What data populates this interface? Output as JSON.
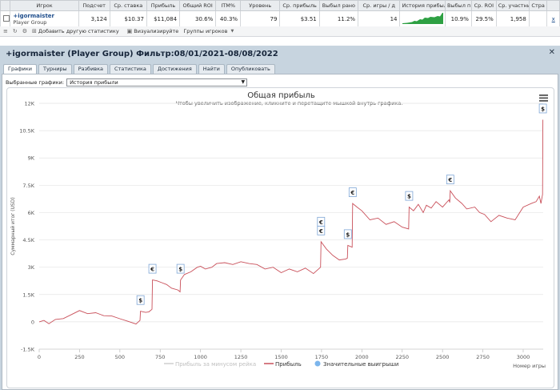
{
  "stats_table": {
    "headers": [
      "",
      "Игрок",
      "Подсчет",
      "Ср. ставка",
      "Прибыль",
      "Общий ROI",
      "ITM%",
      "Уровень",
      "Ср. прибыль",
      "Выбыл рано",
      "Ср. игры / д",
      "История прибыли",
      "Выбыл п",
      "Ср. ROI",
      "Ср. участни",
      "Стра",
      ""
    ],
    "row": {
      "player_name": "+igormaister",
      "player_group": "Player Group",
      "count": "3,124",
      "avg_stake": "$10.37",
      "profit": "$11,084",
      "total_roi": "30.6%",
      "itm": "40.3%",
      "level": "79",
      "avg_profit": "$3.51",
      "early_out": "11.2%",
      "games_per_day": "14",
      "late_out": "10.9%",
      "avg_roi": "29.5%",
      "avg_entrants": "1,958",
      "country": "",
      "remove": "x"
    }
  },
  "toolbar": {
    "add_stat": "Добавить другую статистику",
    "visualize": "Визуализируйте",
    "player_groups": "Группы игроков"
  },
  "panel": {
    "title": "+igormaister (Player Group) Фильтр:08/01/2021-08/08/2022",
    "tabs": [
      "Графики",
      "Турниры",
      "Разбивка",
      "Статистика",
      "Достижения",
      "Найти",
      "Опубликовать"
    ],
    "active_tab": 0,
    "select_label": "Выбранные графики:",
    "select_value": "История прибыли"
  },
  "chart_data": {
    "type": "line",
    "title": "Общая прибыль",
    "subtitle": "Чтобы увеличить изображение, кликните и перетащите мышкой внутрь графика.",
    "xlabel": "Номер игры",
    "ylabel": "Суммарный итог (USD)",
    "xlim": [
      0,
      3124
    ],
    "ylim": [
      -1500,
      12000
    ],
    "x_ticks": [
      "0",
      "250",
      "500",
      "750",
      "1000",
      "1250",
      "1500",
      "1750",
      "2000",
      "2250",
      "2500",
      "2750",
      "3000"
    ],
    "y_ticks": [
      "-1.5K",
      "0",
      "1.5K",
      "3K",
      "4.5K",
      "6K",
      "7.5K",
      "9K",
      "10.5K",
      "12K"
    ],
    "legend": [
      "Прибыль за минусом рейка",
      "Прибыль",
      "Значительные выигрыши"
    ],
    "series": [
      {
        "name": "Прибыль",
        "color": "#c9505a",
        "x": [
          0,
          30,
          60,
          100,
          150,
          200,
          250,
          300,
          350,
          400,
          450,
          500,
          550,
          600,
          625,
          628,
          660,
          680,
          699,
          702,
          730,
          760,
          790,
          820,
          860,
          873,
          876,
          900,
          940,
          980,
          1000,
          1030,
          1070,
          1100,
          1150,
          1200,
          1250,
          1300,
          1350,
          1400,
          1450,
          1500,
          1550,
          1600,
          1650,
          1700,
          1744,
          1747,
          1780,
          1820,
          1860,
          1900,
          1910,
          1913,
          1940,
          1943,
          1970,
          2000,
          2050,
          2100,
          2150,
          2200,
          2250,
          2290,
          2293,
          2320,
          2350,
          2380,
          2400,
          2430,
          2460,
          2500,
          2540,
          2545,
          2548,
          2580,
          2620,
          2650,
          2700,
          2730,
          2760,
          2800,
          2850,
          2900,
          2950,
          3000,
          3050,
          3080,
          3100,
          3110,
          3120,
          3122
        ],
        "y": [
          0,
          80,
          -100,
          130,
          180,
          400,
          620,
          450,
          500,
          340,
          320,
          170,
          30,
          -120,
          80,
          580,
          520,
          550,
          690,
          2300,
          2250,
          2150,
          2050,
          1850,
          1750,
          1650,
          2300,
          2600,
          2750,
          3000,
          3050,
          2900,
          3000,
          3200,
          3250,
          3150,
          3300,
          3200,
          3150,
          2900,
          3000,
          2700,
          2900,
          2750,
          2950,
          2650,
          3000,
          4400,
          4000,
          3650,
          3400,
          3450,
          3500,
          4200,
          4100,
          6500,
          6300,
          6100,
          5600,
          5700,
          5350,
          5500,
          5200,
          5100,
          6300,
          6100,
          6450,
          6000,
          6400,
          6250,
          6600,
          6300,
          6700,
          6550,
          7200,
          6800,
          6500,
          6200,
          6300,
          6000,
          5900,
          5500,
          5850,
          5700,
          5600,
          6300,
          6500,
          6600,
          6900,
          6500,
          7000,
          11100
        ]
      }
    ],
    "markers": [
      {
        "x": 628,
        "y": 580,
        "symbol": "$"
      },
      {
        "x": 702,
        "y": 2300,
        "symbol": "€"
      },
      {
        "x": 876,
        "y": 2300,
        "symbol": "$"
      },
      {
        "x": 1747,
        "y": 4400,
        "symbol": "€"
      },
      {
        "x": 1747,
        "y": 4400,
        "symbol": "€"
      },
      {
        "x": 1913,
        "y": 4200,
        "symbol": "$"
      },
      {
        "x": 1943,
        "y": 6500,
        "symbol": "€"
      },
      {
        "x": 2293,
        "y": 6300,
        "symbol": "$"
      },
      {
        "x": 2548,
        "y": 7200,
        "symbol": "€"
      },
      {
        "x": 3122,
        "y": 11100,
        "symbol": "$"
      }
    ],
    "grid": true,
    "legend_position": "bottom"
  }
}
